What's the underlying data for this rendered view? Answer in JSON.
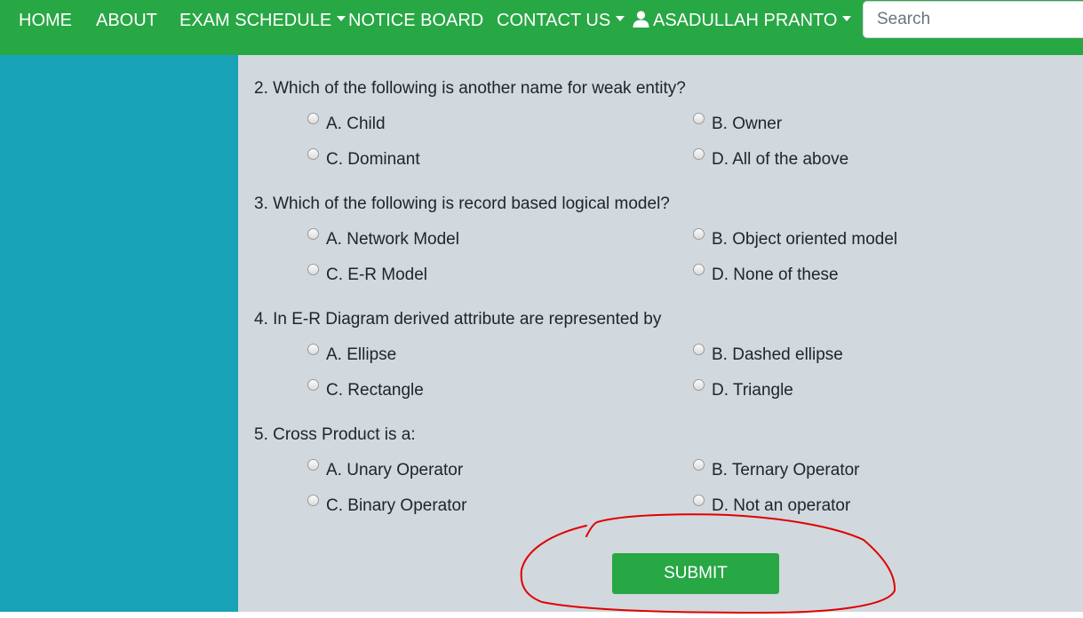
{
  "nav": {
    "items": [
      {
        "label": "HOME",
        "dropdown": false
      },
      {
        "label": "ABOUT",
        "dropdown": false
      },
      {
        "label": "EXAM SCHEDULE",
        "dropdown": true
      },
      {
        "label": "NOTICE BOARD",
        "dropdown": false
      },
      {
        "label": "CONTACT US",
        "dropdown": true
      }
    ],
    "user": {
      "label": "ASADULLAH PRANTO",
      "icon": "user-icon",
      "dropdown": true
    },
    "search": {
      "placeholder": "Search",
      "value": ""
    }
  },
  "colors": {
    "nav_bg": "#28a745",
    "sidebar_bg": "#17a2b8",
    "content_bg": "#d1d8de",
    "submit_bg": "#28a745",
    "annotation": "#e00000"
  },
  "quiz": {
    "questions": [
      {
        "text": "2. Which of the following is another name for weak entity?",
        "options": [
          "A. Child",
          "B. Owner",
          "C. Dominant",
          "D. All of the above"
        ]
      },
      {
        "text": "3. Which of the following is record based logical model?",
        "options": [
          "A. Network Model",
          "B. Object oriented model",
          "C. E-R Model",
          "D. None of these"
        ]
      },
      {
        "text": "4. In E-R Diagram derived attribute are represented by",
        "options": [
          "A. Ellipse",
          "B. Dashed ellipse",
          "C. Rectangle",
          "D. Triangle"
        ]
      },
      {
        "text": "5. Cross Product is a:",
        "options": [
          "A. Unary Operator",
          "B. Ternary Operator",
          "C. Binary Operator",
          "D. Not an operator"
        ]
      }
    ],
    "submit_label": "SUBMIT"
  }
}
